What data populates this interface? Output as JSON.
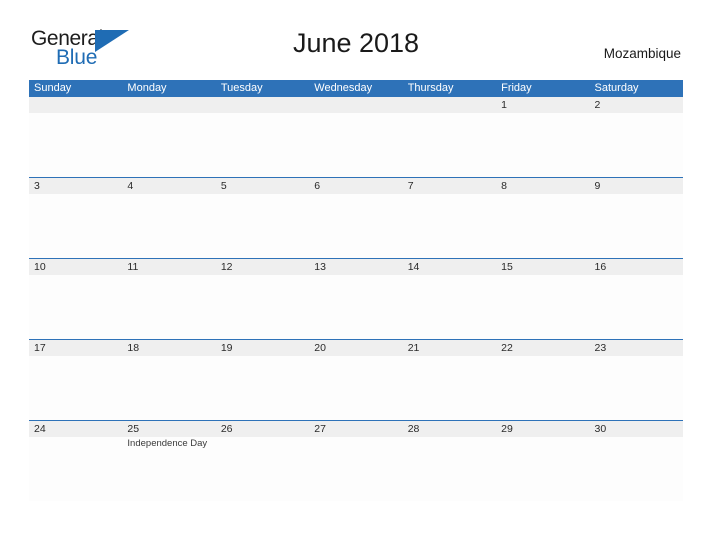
{
  "brand": {
    "name_part1": "General",
    "name_part2": "Blue",
    "triangle_icon": "triangle-icon",
    "accent_color": "#1f6cb4"
  },
  "header": {
    "title": "June 2018",
    "country": "Mozambique"
  },
  "calendar": {
    "month": "June",
    "year": "2018",
    "header_bg_color": "#2e72b8",
    "day_band_color": "#efefef",
    "weekdays": [
      "Sunday",
      "Monday",
      "Tuesday",
      "Wednesday",
      "Thursday",
      "Friday",
      "Saturday"
    ],
    "weeks": [
      [
        {
          "day": "",
          "event": ""
        },
        {
          "day": "",
          "event": ""
        },
        {
          "day": "",
          "event": ""
        },
        {
          "day": "",
          "event": ""
        },
        {
          "day": "",
          "event": ""
        },
        {
          "day": "1",
          "event": ""
        },
        {
          "day": "2",
          "event": ""
        }
      ],
      [
        {
          "day": "3",
          "event": ""
        },
        {
          "day": "4",
          "event": ""
        },
        {
          "day": "5",
          "event": ""
        },
        {
          "day": "6",
          "event": ""
        },
        {
          "day": "7",
          "event": ""
        },
        {
          "day": "8",
          "event": ""
        },
        {
          "day": "9",
          "event": ""
        }
      ],
      [
        {
          "day": "10",
          "event": ""
        },
        {
          "day": "11",
          "event": ""
        },
        {
          "day": "12",
          "event": ""
        },
        {
          "day": "13",
          "event": ""
        },
        {
          "day": "14",
          "event": ""
        },
        {
          "day": "15",
          "event": ""
        },
        {
          "day": "16",
          "event": ""
        }
      ],
      [
        {
          "day": "17",
          "event": ""
        },
        {
          "day": "18",
          "event": ""
        },
        {
          "day": "19",
          "event": ""
        },
        {
          "day": "20",
          "event": ""
        },
        {
          "day": "21",
          "event": ""
        },
        {
          "day": "22",
          "event": ""
        },
        {
          "day": "23",
          "event": ""
        }
      ],
      [
        {
          "day": "24",
          "event": ""
        },
        {
          "day": "25",
          "event": "Independence Day"
        },
        {
          "day": "26",
          "event": ""
        },
        {
          "day": "27",
          "event": ""
        },
        {
          "day": "28",
          "event": ""
        },
        {
          "day": "29",
          "event": ""
        },
        {
          "day": "30",
          "event": ""
        }
      ]
    ]
  }
}
